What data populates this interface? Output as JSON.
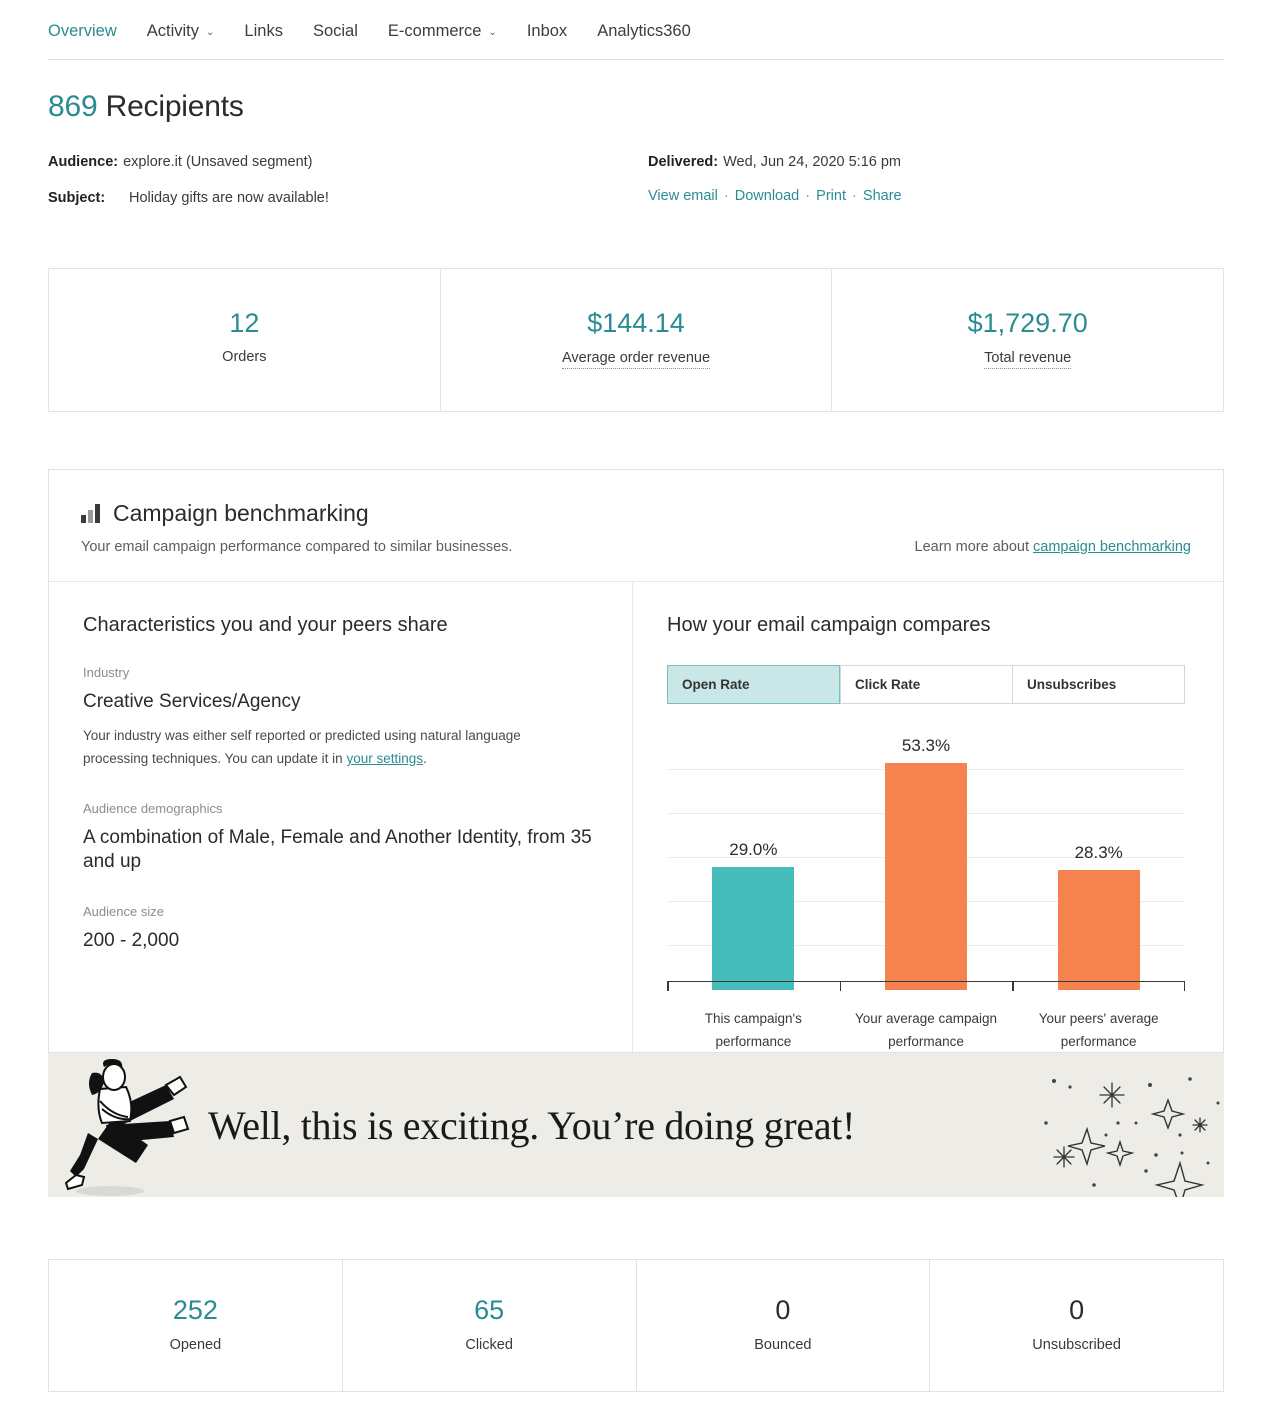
{
  "nav": {
    "items": [
      {
        "label": "Overview",
        "active": true,
        "caret": false
      },
      {
        "label": "Activity",
        "active": false,
        "caret": true
      },
      {
        "label": "Links",
        "active": false,
        "caret": false
      },
      {
        "label": "Social",
        "active": false,
        "caret": false
      },
      {
        "label": "E-commerce",
        "active": false,
        "caret": true
      },
      {
        "label": "Inbox",
        "active": false,
        "caret": false
      },
      {
        "label": "Analytics360",
        "active": false,
        "caret": false
      }
    ],
    "caret_glyph": "⌄"
  },
  "header": {
    "recipient_count": "869",
    "recipient_word": "Recipients",
    "audience_label": "Audience:",
    "audience_value": "explore.it (Unsaved segment)",
    "subject_label": "Subject:",
    "subject_value": "Holiday gifts are now available!",
    "delivered_label": "Delivered:",
    "delivered_value": "Wed, Jun 24, 2020 5:16 pm",
    "actions": [
      "View email",
      "Download",
      "Print",
      "Share"
    ],
    "action_separator": "·"
  },
  "ecommerce_stats": [
    {
      "value": "12",
      "label": "Orders",
      "teal": true,
      "hint": false
    },
    {
      "value": "$144.14",
      "label": "Average order revenue",
      "teal": true,
      "hint": true
    },
    {
      "value": "$1,729.70",
      "label": "Total revenue",
      "teal": true,
      "hint": true
    }
  ],
  "benchmarking": {
    "title": "Campaign benchmarking",
    "subtitle": "Your email campaign performance compared to similar businesses.",
    "learn_more_prefix": "Learn more about ",
    "learn_more_link": "campaign benchmarking",
    "left": {
      "title": "Characteristics you and your peers share",
      "fields": [
        {
          "label": "Industry",
          "value": "Creative Services/Agency",
          "note_before": "Your industry was either self reported or predicted using natural language processing techniques. You can update it in ",
          "note_link": "your settings",
          "note_after": "."
        },
        {
          "label": "Audience demographics",
          "value": "A combination of Male, Female and Another Identity, from 35 and up"
        },
        {
          "label": "Audience size",
          "value": "200 - 2,000"
        }
      ]
    },
    "right": {
      "title": "How your email campaign compares",
      "tabs": [
        {
          "label": "Open Rate",
          "active": true
        },
        {
          "label": "Click Rate",
          "active": false
        },
        {
          "label": "Unsubscribes",
          "active": false
        }
      ]
    }
  },
  "chart_data": {
    "type": "bar",
    "title": "How your email campaign compares",
    "xlabel": "",
    "ylabel": "",
    "ylim": [
      0,
      62
    ],
    "grid": true,
    "gridlines": [
      10.3,
      20.7,
      31.0,
      41.3,
      51.7
    ],
    "legend": "none",
    "categories": [
      "This campaign's performance",
      "Your average campaign performance",
      "Your peers' average performance"
    ],
    "values": [
      29.0,
      53.3,
      28.3
    ],
    "value_labels": [
      "29.0%",
      "53.3%",
      "28.3%"
    ],
    "colors": [
      "#45BDBD",
      "#F5834F",
      "#F5834F"
    ],
    "metric": "Open Rate",
    "unit": "%"
  },
  "banner": {
    "message": "Well, this is exciting. You’re doing great!",
    "background": "#edece7"
  },
  "engagement_stats": [
    {
      "value": "252",
      "label": "Opened",
      "teal": true
    },
    {
      "value": "65",
      "label": "Clicked",
      "teal": true
    },
    {
      "value": "0",
      "label": "Bounced",
      "teal": false
    },
    {
      "value": "0",
      "label": "Unsubscribed",
      "teal": false
    }
  ],
  "theme": {
    "accent_teal": "#2a8c92",
    "bar_teal": "#45BDBD",
    "bar_orange": "#F5834F",
    "tab_active_bg": "#c9e7e6",
    "banner_bg": "#edece7"
  }
}
